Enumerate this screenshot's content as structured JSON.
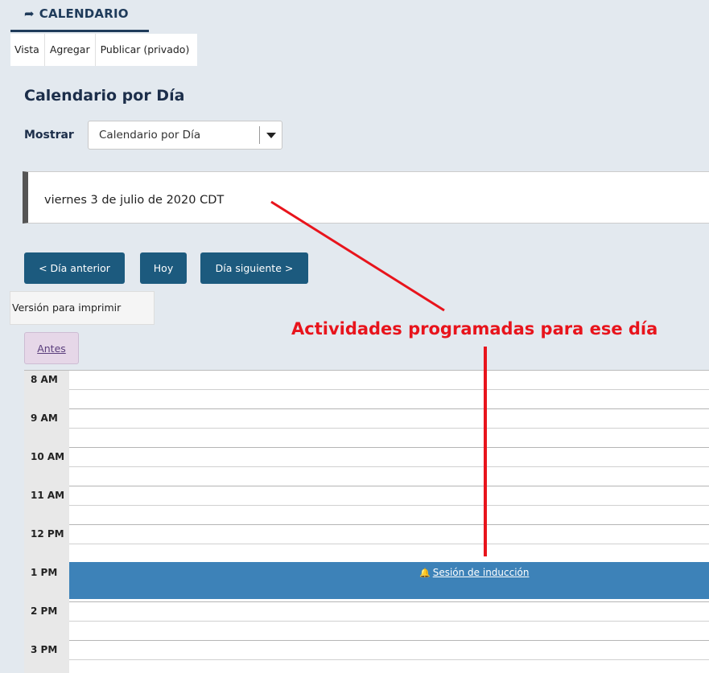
{
  "header": {
    "tool_title": "CALENDARIO",
    "tool_icon": "share-arrow-icon"
  },
  "tabs": [
    {
      "label": "Vista"
    },
    {
      "label": "Agregar"
    },
    {
      "label": "Publicar (privado)"
    }
  ],
  "page": {
    "title": "Calendario por Día",
    "show_label": "Mostrar",
    "view_select": {
      "selected": "Calendario por Día"
    },
    "date_display": "viernes 3 de julio de 2020 CDT"
  },
  "nav": {
    "prev_label": "< Día anterior",
    "today_label": "Hoy",
    "next_label": "Día siguiente >",
    "print_label": "Versión para imprimir",
    "earlier_label": "Antes"
  },
  "annotation": {
    "text": "Actividades programadas para ese día",
    "color": "#e8141c"
  },
  "calendar": {
    "hours": [
      "8 AM",
      "9 AM",
      "10 AM",
      "11 AM",
      "12 PM",
      "1 PM",
      "2 PM",
      "3 PM"
    ],
    "event": {
      "hour": "1 PM",
      "title": "Sesión de inducción",
      "icon": "bell-icon",
      "color": "#3d82b8"
    }
  },
  "colors": {
    "background": "#e3e9ef",
    "primary_button": "#1c5a7e",
    "title": "#1c2e4a"
  }
}
